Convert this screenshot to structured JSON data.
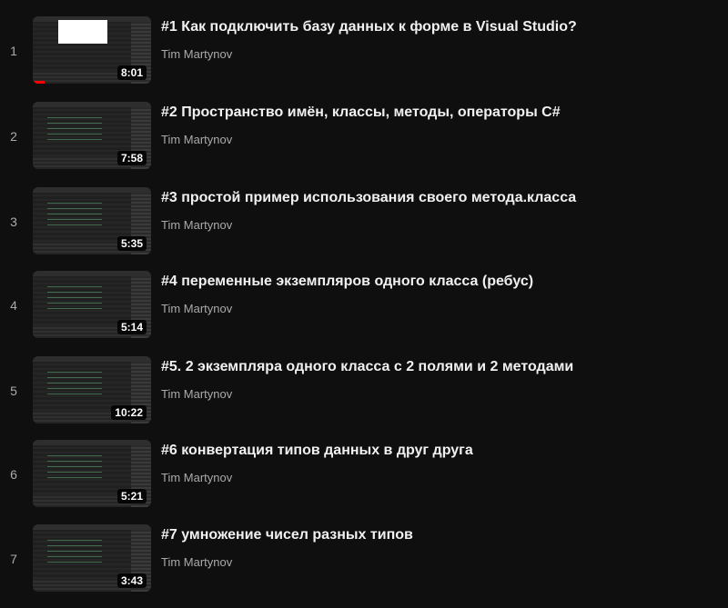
{
  "playlist": {
    "items": [
      {
        "index": "1",
        "title": "#1 Как подключить базу данных к форме в Visual Studio?",
        "channel": "Tim Martynov",
        "duration": "8:01",
        "watched_progress": 0.1
      },
      {
        "index": "2",
        "title": "#2 Пространство имён, классы, методы, операторы С#",
        "channel": "Tim Martynov",
        "duration": "7:58"
      },
      {
        "index": "3",
        "title": "#3 простой пример использования своего метода.класса",
        "channel": "Tim Martynov",
        "duration": "5:35"
      },
      {
        "index": "4",
        "title": "#4 переменные экземпляров одного класса (ребус)",
        "channel": "Tim Martynov",
        "duration": "5:14"
      },
      {
        "index": "5",
        "title": "#5. 2 экземпляра одного класса с 2 полями и 2 методами",
        "channel": "Tim Martynov",
        "duration": "10:22"
      },
      {
        "index": "6",
        "title": "#6 конвертация типов данных в друг друга",
        "channel": "Tim Martynov",
        "duration": "5:21"
      },
      {
        "index": "7",
        "title": "#7 умножение чисел разных типов",
        "channel": "Tim Martynov",
        "duration": "3:43"
      }
    ]
  },
  "colors": {
    "background": "#0f0f0f",
    "title": "#f1f1f1",
    "secondary_text": "#aaaaaa",
    "progress": "#ff0000"
  }
}
